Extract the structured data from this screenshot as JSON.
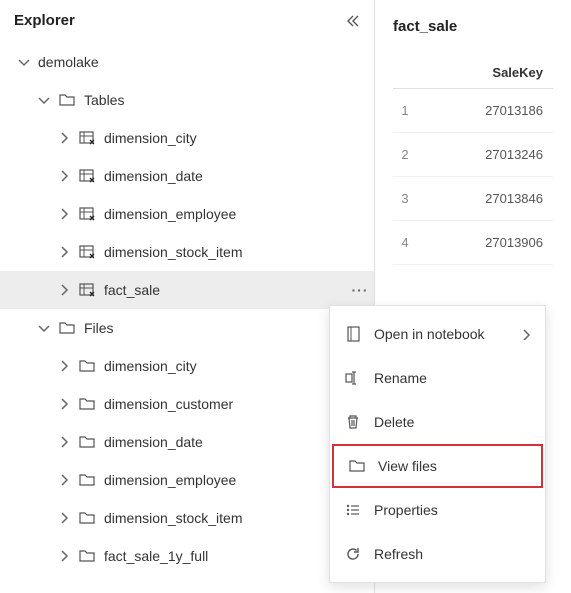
{
  "explorer": {
    "title": "Explorer",
    "root": {
      "label": "demolake",
      "groups": [
        {
          "label": "Tables",
          "items": [
            {
              "label": "dimension_city"
            },
            {
              "label": "dimension_date"
            },
            {
              "label": "dimension_employee"
            },
            {
              "label": "dimension_stock_item"
            },
            {
              "label": "fact_sale",
              "selected": true
            }
          ]
        },
        {
          "label": "Files",
          "items": [
            {
              "label": "dimension_city"
            },
            {
              "label": "dimension_customer"
            },
            {
              "label": "dimension_date"
            },
            {
              "label": "dimension_employee"
            },
            {
              "label": "dimension_stock_item"
            },
            {
              "label": "fact_sale_1y_full"
            }
          ]
        }
      ]
    }
  },
  "preview": {
    "title": "fact_sale",
    "column": "SaleKey",
    "rows": [
      {
        "idx": "1",
        "val": "27013186"
      },
      {
        "idx": "2",
        "val": "27013246"
      },
      {
        "idx": "3",
        "val": "27013846"
      },
      {
        "idx": "4",
        "val": "27013906"
      }
    ]
  },
  "menu": {
    "items": [
      {
        "label": "Open in notebook",
        "icon": "notebook",
        "submenu": true
      },
      {
        "label": "Rename",
        "icon": "rename"
      },
      {
        "label": "Delete",
        "icon": "delete"
      },
      {
        "label": "View files",
        "icon": "folder",
        "highlighted": true
      },
      {
        "label": "Properties",
        "icon": "properties"
      },
      {
        "label": "Refresh",
        "icon": "refresh"
      }
    ]
  }
}
